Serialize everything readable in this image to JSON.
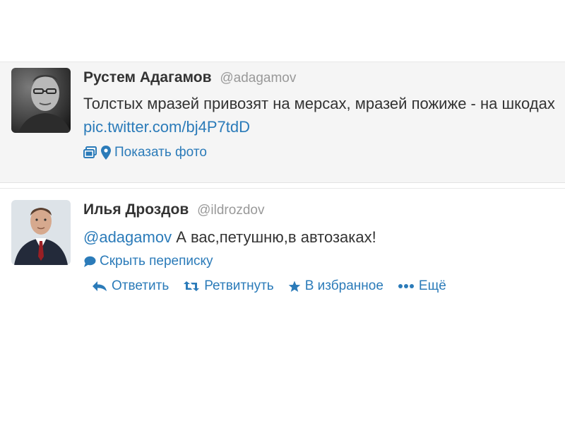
{
  "colors": {
    "link": "#2b7bb9",
    "text": "#333333",
    "muted": "#999999",
    "tweet_bg_highlighted": "#f5f5f5"
  },
  "tweets": [
    {
      "fullname": "Рустем Адагамов",
      "screen_name": "@adagamov",
      "text": "Толстых мразей привозят на мерсах, мразей пожиже - на шкодах ",
      "link": "pic.twitter.com/bj4P7tdD",
      "details": {
        "icons": [
          "photo-icon",
          "location-pin-icon"
        ],
        "label": "Показать фото"
      }
    },
    {
      "fullname": "Илья Дроздов",
      "screen_name": "@ildrozdov",
      "mention": "@adagamov",
      "text": " А вас,петушню,в автозаках!",
      "details": {
        "icons": [
          "conversation-bubble-icon"
        ],
        "label": "Скрыть переписку"
      },
      "actions": [
        {
          "icon": "reply-icon",
          "label": "Ответить"
        },
        {
          "icon": "retweet-icon",
          "label": "Ретвитнуть"
        },
        {
          "icon": "star-icon",
          "label": "В избранное"
        },
        {
          "icon": "more-dots-icon",
          "label": "Ещё"
        }
      ]
    }
  ]
}
